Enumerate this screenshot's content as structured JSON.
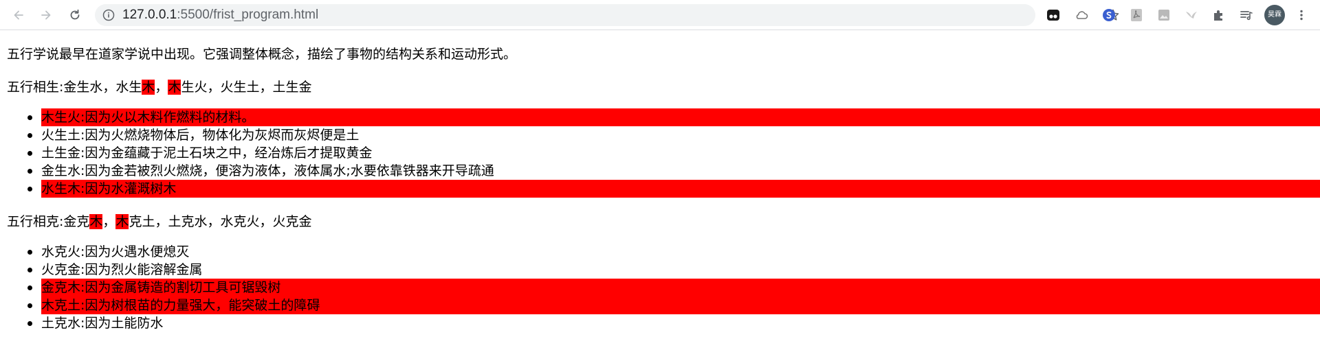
{
  "browser": {
    "url_host": "127.0.0.1",
    "url_rest": ":5500/frist_program.html",
    "avatar_text": "昊霖"
  },
  "intro": "五行学说最早在道家学说中出现。它强调整体概念，描绘了事物的结构关系和运动形式。",
  "sheng": {
    "prefix": "五行相生:金生水，水生",
    "hl1": "木",
    "mid": "，",
    "hl2": "木",
    "suffix": "生火，火生土，土生金",
    "items": [
      {
        "text": "木生火:因为火以木料作燃料的材料。",
        "highlight": true
      },
      {
        "text": "火生土:因为火燃烧物体后，物体化为灰烬而灰烬便是土",
        "highlight": false
      },
      {
        "text": "土生金:因为金蕴藏于泥土石块之中，经冶炼后才提取黄金",
        "highlight": false
      },
      {
        "text": "金生水:因为金若被烈火燃烧，便溶为液体，液体属水;水要依靠铁器来开导疏通",
        "highlight": false
      },
      {
        "text": "水生木:因为水灌溉树木",
        "highlight": true
      }
    ]
  },
  "ke": {
    "prefix": "五行相克:金克",
    "hl1": "木",
    "mid": "，",
    "hl2": "木",
    "suffix": "克土，土克水，水克火，火克金",
    "items": [
      {
        "text": "水克火:因为火遇水便熄灭",
        "highlight": false
      },
      {
        "text": "火克金:因为烈火能溶解金属",
        "highlight": false
      },
      {
        "text": "金克木:因为金属铸造的割切工具可锯毁树",
        "highlight": true
      },
      {
        "text": "木克土:因为树根苗的力量强大，能突破土的障碍",
        "highlight": true
      },
      {
        "text": "土克水:因为土能防水",
        "highlight": false
      }
    ]
  },
  "colors": {
    "highlight": "#ff0000"
  }
}
